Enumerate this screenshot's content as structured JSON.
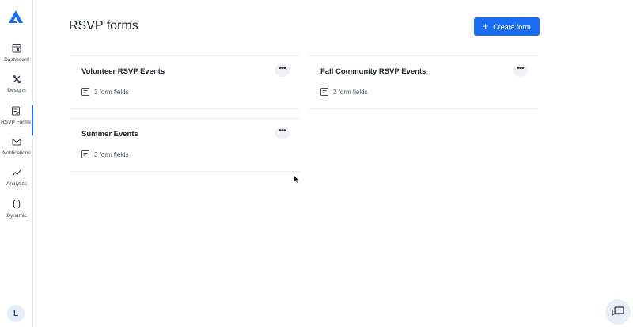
{
  "app": {
    "brand_color": "#1a6df0",
    "logo_icon": "app-logo-icon"
  },
  "sidebar": {
    "items": [
      {
        "label": "Dashboard",
        "icon": "dashboard-icon"
      },
      {
        "label": "Designs",
        "icon": "designs-icon"
      },
      {
        "label": "RSVP Forms",
        "icon": "rsvp-forms-icon",
        "active": true
      },
      {
        "label": "Notifications",
        "icon": "notifications-icon"
      },
      {
        "label": "Analytics",
        "icon": "analytics-icon"
      },
      {
        "label": "Dynamic",
        "icon": "dynamic-icon"
      }
    ],
    "user_initial": "L"
  },
  "header": {
    "title": "RSVP forms",
    "create_label": "Create form",
    "create_icon": "plus-icon"
  },
  "forms": [
    {
      "title": "Volunteer RSVP Events",
      "fields": "3 form fields"
    },
    {
      "title": "Fall Community RSVP Events",
      "fields": "2 form fields"
    },
    {
      "title": "Summer Events",
      "fields": "3 form fields"
    }
  ],
  "more_label": "•••"
}
